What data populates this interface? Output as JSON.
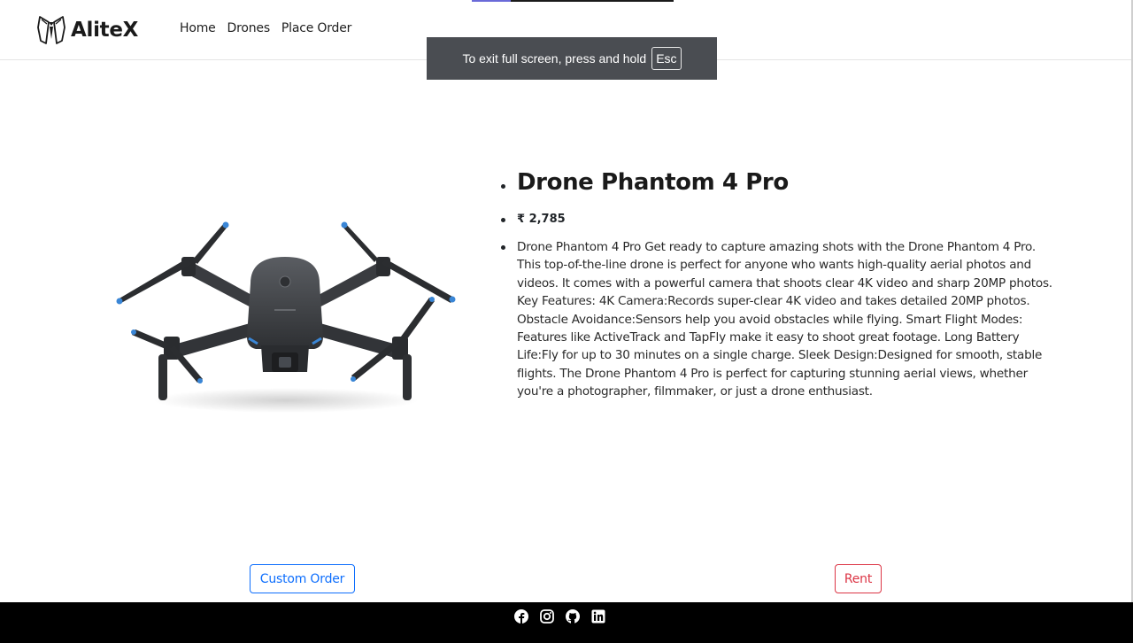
{
  "brand": {
    "name": "AliteX",
    "logo_icon": "tuxedo-icon"
  },
  "nav": {
    "items": [
      {
        "label": "Home"
      },
      {
        "label": "Drones"
      },
      {
        "label": "Place Order"
      }
    ]
  },
  "fullscreen_toast": {
    "message": "To exit full screen, press and hold",
    "key": "Esc"
  },
  "product": {
    "title": "Drone Phantom 4 Pro",
    "price": "₹ 2,785",
    "description": "Drone Phantom 4 Pro Get ready to capture amazing shots with the Drone Phantom 4 Pro. This top-of-the-line drone is perfect for anyone who wants high-quality aerial photos and videos. It comes with a powerful camera that shoots clear 4K video and sharp 20MP photos. Key Features: 4K Camera:Records super-clear 4K video and takes detailed 20MP photos. Obstacle Avoidance:Sensors help you avoid obstacles while flying. Smart Flight Modes: Features like ActiveTrack and TapFly make it easy to shoot great footage. Long Battery Life:Fly for up to 30 minutes on a single charge. Sleek Design:Designed for smooth, stable flights. The Drone Phantom 4 Pro is perfect for capturing stunning aerial views, whether you're a photographer, filmmaker, or just a drone enthusiast.",
    "image_icon": "drone-image"
  },
  "actions": {
    "custom_order_label": "Custom Order",
    "rent_label": "Rent"
  },
  "footer": {
    "social_icons": [
      "facebook-icon",
      "instagram-icon",
      "github-icon",
      "linkedin-icon"
    ]
  },
  "colors": {
    "primary": "#0d6efd",
    "danger": "#dc3545",
    "footer_bg": "#000000",
    "toast_bg": "#4a4d52"
  }
}
